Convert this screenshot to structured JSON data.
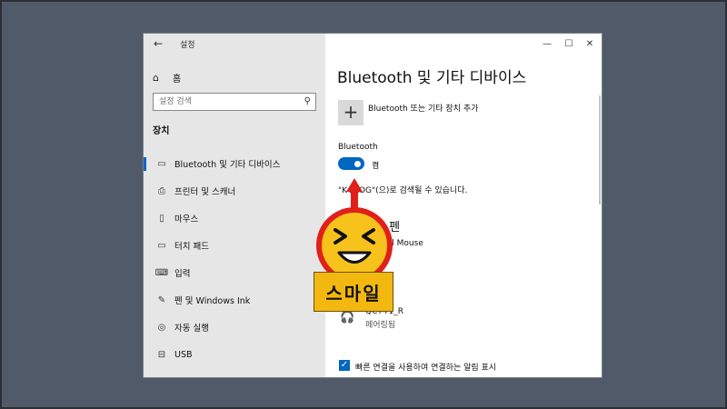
{
  "window": {
    "app_title": "설정",
    "back_icon": "back-arrow-icon",
    "controls": [
      "minimize-icon",
      "maximize-icon",
      "close-icon"
    ]
  },
  "sidebar": {
    "home_label": "홈",
    "search_placeholder": "설정 검색",
    "section_title": "장치",
    "items": [
      {
        "label": "Bluetooth 및 기타 디바이스",
        "icon": "bluetooth-device-icon",
        "active": true
      },
      {
        "label": "프린터 및 스캐너",
        "icon": "printer-icon",
        "active": false
      },
      {
        "label": "마우스",
        "icon": "mouse-icon",
        "active": false
      },
      {
        "label": "터치 패드",
        "icon": "touchpad-icon",
        "active": false
      },
      {
        "label": "입력",
        "icon": "keyboard-icon",
        "active": false
      },
      {
        "label": "펜 및 Windows Ink",
        "icon": "pen-icon",
        "active": false
      },
      {
        "label": "자동 실행",
        "icon": "autoplay-icon",
        "active": false
      },
      {
        "label": "USB",
        "icon": "usb-icon",
        "active": false
      }
    ]
  },
  "main": {
    "title": "Bluetooth 및 기타 디바이스",
    "add_device_label": "Bluetooth 또는 기타 장치 추가",
    "bluetooth_label": "Bluetooth",
    "toggle_state": "켬",
    "discoverable_text": "\"K-BLOG\"(으)로 검색될 수 있습니다.",
    "section_keyboard": "키보드 및 펜",
    "device1_name": "Optical Mouse",
    "device2_name": "QCY-T1_R",
    "device2_status": "페어링됨",
    "quick_connect_label": "빠른 연결을 사용하여 연결하는 알림 표시",
    "quick_connect_checked": true
  },
  "overlay": {
    "sticker_text": "스마일",
    "colors": {
      "sticker_yellow": "#f3b80f",
      "arrow_red": "#e0201b",
      "accent": "#0067c0"
    }
  }
}
